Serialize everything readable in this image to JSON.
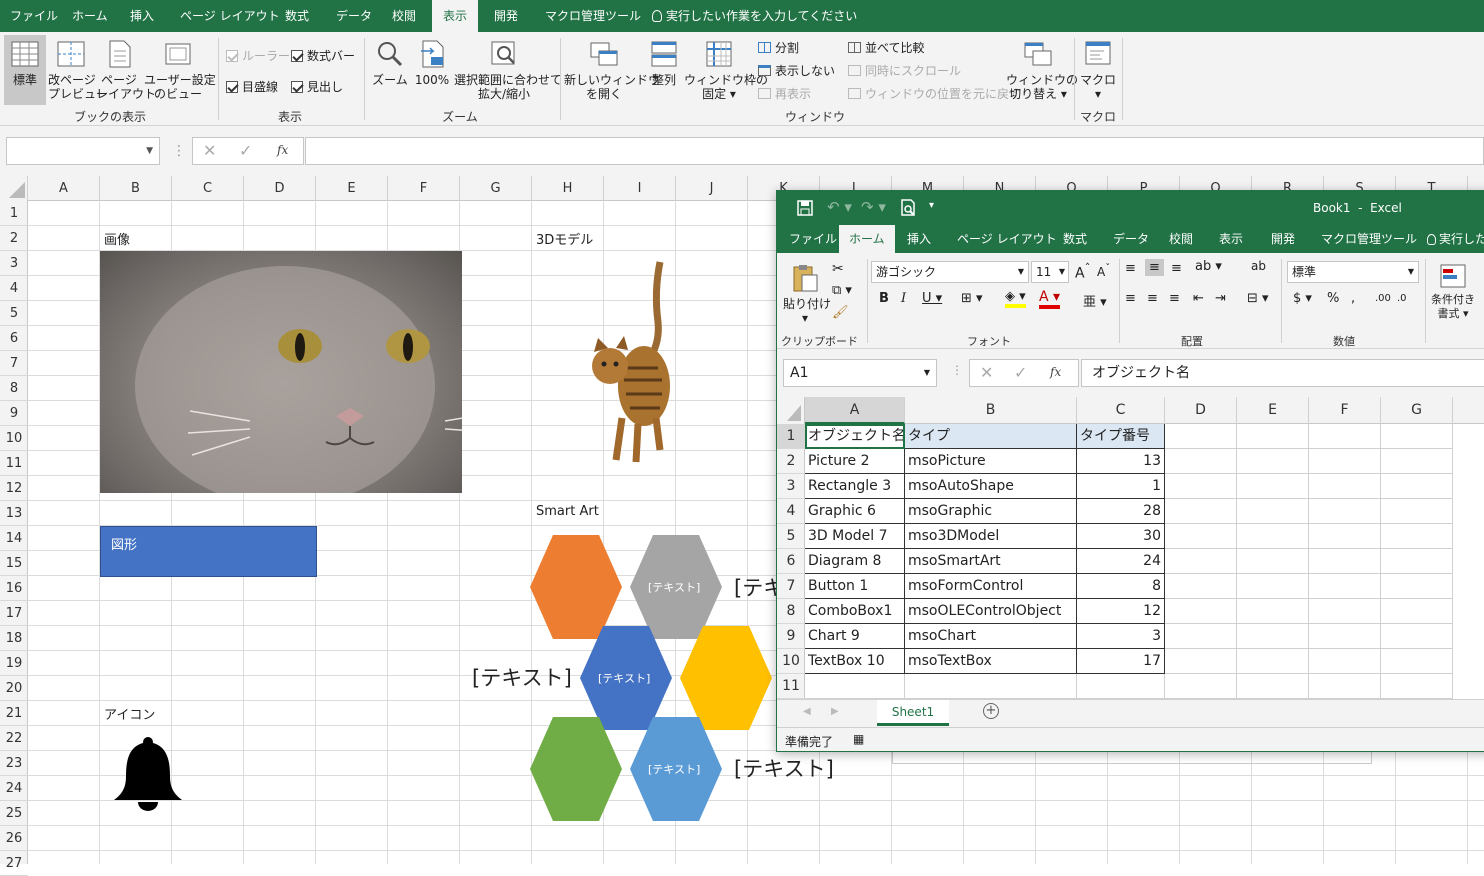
{
  "main_tabs": [
    "ファイル",
    "ホーム",
    "挿入",
    "ページ レイアウト",
    "数式",
    "データ",
    "校閲",
    "表示",
    "開発",
    "マクロ管理ツール",
    "実行したい作業を入力してください"
  ],
  "ribbon": {
    "normal": "標準",
    "pagebreak_1": "改ページ",
    "pagebreak_2": "プレビュー",
    "pagelayout_1": "ページ",
    "pagelayout_2": "レイアウト",
    "custom_1": "ユーザー設定",
    "custom_2": "のビュー",
    "group_workbook": "ブックの表示",
    "ruler": "ルーラー",
    "formulabar": "数式バー",
    "gridlines": "目盛線",
    "headings": "見出し",
    "group_show": "表示",
    "zoom": "ズーム",
    "zoom100": "100%",
    "zoomsel_1": "選択範囲に合わせて",
    "zoomsel_2": "拡大/縮小",
    "group_zoom": "ズーム",
    "newwin_1": "新しいウィンドウ",
    "newwin_2": "を開く",
    "arrange": "整列",
    "freeze_1": "ウィンドウ枠の",
    "freeze_2": "固定",
    "split": "分割",
    "hide": "表示しない",
    "unhide": "再表示",
    "sidebyside": "並べて比較",
    "syncscroll": "同時にスクロール",
    "resetpos": "ウィンドウの位置を元に戻す",
    "switch_1": "ウィンドウの",
    "switch_2": "切り替え",
    "group_window": "ウィンドウ",
    "macro": "マクロ",
    "group_macro": "マクロ"
  },
  "formula": {
    "fx": "fx"
  },
  "columns": [
    "A",
    "B",
    "C",
    "D",
    "E",
    "F",
    "G",
    "H",
    "I",
    "J",
    "K",
    "L",
    "M",
    "N",
    "O",
    "P",
    "Q",
    "R",
    "S",
    "T"
  ],
  "rows": [
    "1",
    "2",
    "3",
    "4",
    "5",
    "6",
    "7",
    "8",
    "9",
    "10",
    "11",
    "12",
    "13",
    "14",
    "15",
    "16",
    "17",
    "18",
    "19",
    "20",
    "21",
    "22",
    "23",
    "24",
    "25",
    "26",
    "27"
  ],
  "sheet": {
    "label_image": "画像",
    "label_3d": "3Dモデル",
    "label_shape": "図形",
    "label_smartart": "Smart Art",
    "label_icon": "アイコン",
    "smart_text": "[テキスト]",
    "smart_big": "[テキスト]",
    "smart_big_partial": "[テキ"
  },
  "win2": {
    "title": "Book1  -  Excel",
    "tabs": [
      "ファイル",
      "ホーム",
      "挿入",
      "ページ レイアウト",
      "数式",
      "データ",
      "校閲",
      "表示",
      "開発",
      "マクロ管理ツール",
      "実行したい"
    ],
    "font_name": "游ゴシック",
    "font_size": "11",
    "number_format": "標準",
    "paste": "貼り付け",
    "clipboard": "クリップボード",
    "font": "フォント",
    "alignment": "配置",
    "number": "数値",
    "cond_1": "条件付き",
    "cond_2": "書式",
    "namebox": "A1",
    "formula_value": "オブジェクト名",
    "col_headers": [
      "A",
      "B",
      "C",
      "D",
      "E",
      "F",
      "G"
    ],
    "row_headers": [
      "1",
      "2",
      "3",
      "4",
      "5",
      "6",
      "7",
      "8",
      "9",
      "10",
      "11"
    ],
    "table": [
      [
        "オブジェクト名",
        "タイプ",
        "タイプ番号"
      ],
      [
        "Picture 2",
        "msoPicture",
        "13"
      ],
      [
        "Rectangle 3",
        "msoAutoShape",
        "1"
      ],
      [
        "Graphic 6",
        "msoGraphic",
        "28"
      ],
      [
        "3D Model 7",
        "mso3DModel",
        "30"
      ],
      [
        "Diagram 8",
        "msoSmartArt",
        "24"
      ],
      [
        "Button 1",
        "msoFormControl",
        "8"
      ],
      [
        "ComboBox1",
        "msoOLEControlObject",
        "12"
      ],
      [
        "Chart 9",
        "msoChart",
        "3"
      ],
      [
        "TextBox 10",
        "msoTextBox",
        "17"
      ]
    ],
    "sheet_tab": "Sheet1",
    "status": "準備完了"
  },
  "colors": {
    "excel_green": "#217346",
    "shape_blue": "#4472c4",
    "hex_orange": "#ed7d31",
    "hex_gray": "#a5a5a5",
    "hex_blue": "#4472c4",
    "hex_yellow": "#ffc000",
    "hex_green": "#70ad47",
    "hex_lightblue": "#5b9bd5"
  }
}
